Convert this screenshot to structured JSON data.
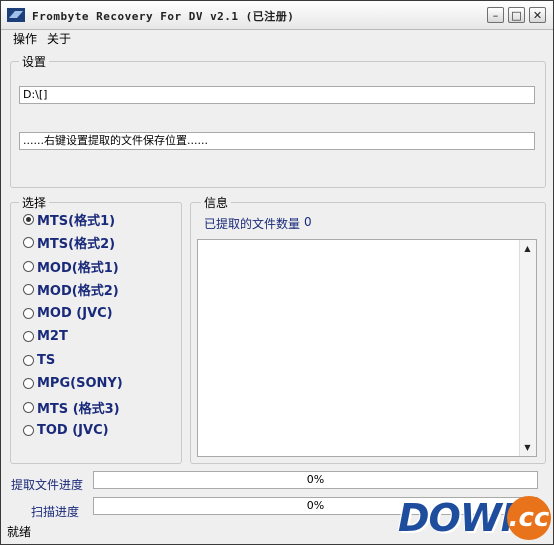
{
  "window": {
    "title": "Frombyte Recovery For DV v2.1 (已注册)",
    "min_glyph": "–",
    "max_glyph": "□",
    "close_glyph": "✕"
  },
  "menu": {
    "items": [
      {
        "label": "操作"
      },
      {
        "label": "关于"
      }
    ]
  },
  "settings": {
    "label": "设置",
    "path_value": "D:\\[]",
    "hint_value": "......右键设置提取的文件保存位置......"
  },
  "select": {
    "label": "选择",
    "options": [
      {
        "label": "MTS(格式1)",
        "checked": true
      },
      {
        "label": "MTS(格式2)",
        "checked": false
      },
      {
        "label": "MOD(格式1)",
        "checked": false
      },
      {
        "label": "MOD(格式2)",
        "checked": false
      },
      {
        "label": "MOD (JVC)",
        "checked": false
      },
      {
        "label": "M2T",
        "checked": false
      },
      {
        "label": "TS",
        "checked": false
      },
      {
        "label": "MPG(SONY)",
        "checked": false
      },
      {
        "label": "MTS (格式3)",
        "checked": false
      },
      {
        "label": "TOD (JVC)",
        "checked": false
      }
    ]
  },
  "info": {
    "label": "信息",
    "extracted_label": "已提取的文件数量",
    "extracted_count": "0"
  },
  "progress": {
    "extract_label": "提取文件进度",
    "extract_value": "0%",
    "scan_label": "扫描进度",
    "scan_value": "0%"
  },
  "status": {
    "text": "就绪"
  },
  "watermark": {
    "text": "DOWN",
    "suffix": ".cc"
  },
  "colors": {
    "accent_text": "#1a2a7a",
    "logo_blue": "#1f4d9e",
    "logo_orange": "#e8731a"
  }
}
